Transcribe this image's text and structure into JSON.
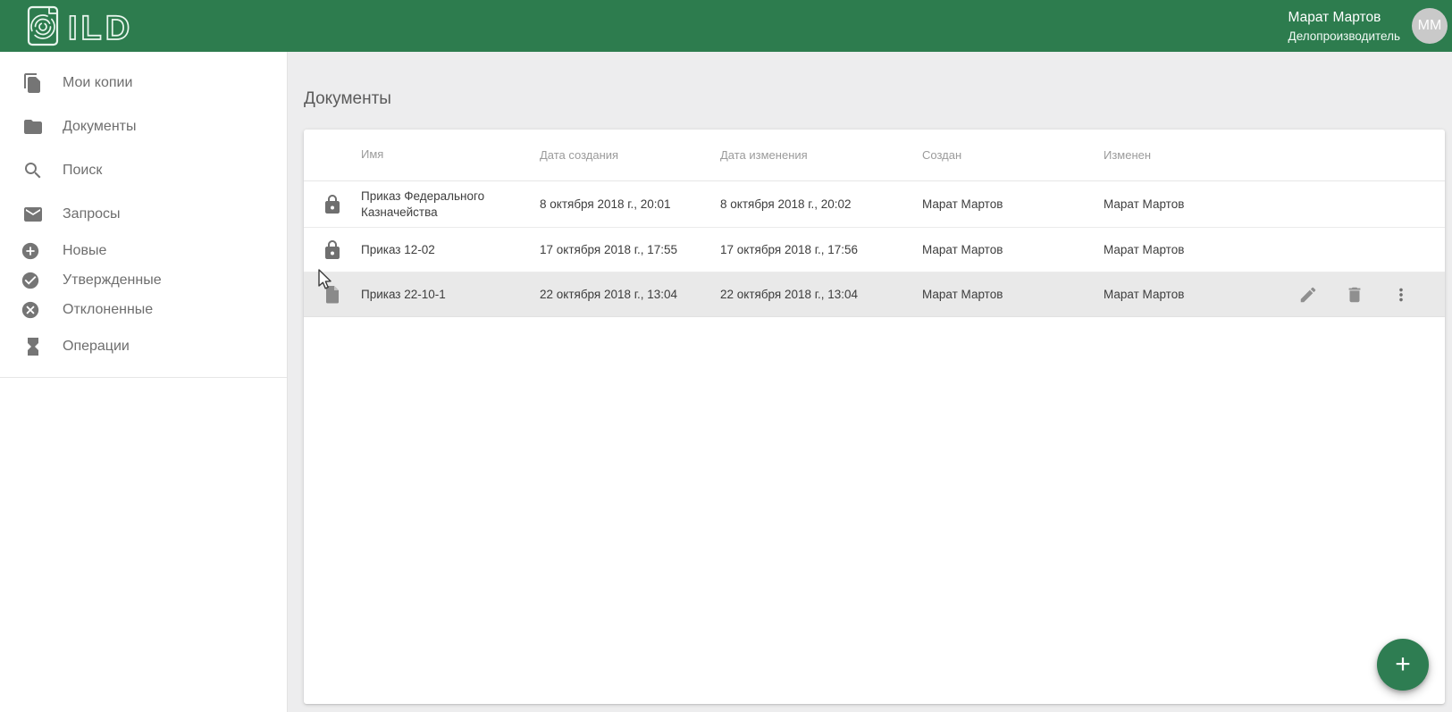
{
  "topbar": {
    "logo_text": "ILD",
    "user": {
      "name": "Марат Мартов",
      "role": "Делопроизводитель",
      "avatar_initials": "MM"
    }
  },
  "sidebar": {
    "items": [
      {
        "label": "Мои копии",
        "icon": "copies-icon",
        "sub": false
      },
      {
        "label": "Документы",
        "icon": "folder-icon",
        "sub": false
      },
      {
        "label": "Поиск",
        "icon": "search-icon",
        "sub": false
      },
      {
        "label": "Запросы",
        "icon": "mail-icon",
        "sub": false
      },
      {
        "label": "Новые",
        "icon": "add-circle-icon",
        "sub": true
      },
      {
        "label": "Утвержденные",
        "icon": "check-circle-icon",
        "sub": true
      },
      {
        "label": "Отклоненные",
        "icon": "cancel-circle-icon",
        "sub": true
      },
      {
        "label": "Операции",
        "icon": "hourglass-icon",
        "sub": false
      }
    ]
  },
  "main": {
    "title": "Документы",
    "table": {
      "columns": [
        "Имя",
        "Дата создания",
        "Дата изменения",
        "Создан",
        "Изменен"
      ],
      "rows": [
        {
          "icon": "lock-icon",
          "name": "Приказ Федерального Казначейства",
          "created": "8 октября 2018 г., 20:01",
          "modified": "8 октября 2018 г., 20:02",
          "created_by": "Марат Мартов",
          "modified_by": "Марат Мартов",
          "selected": false
        },
        {
          "icon": "lock-icon",
          "name": "Приказ 12-02",
          "created": "17 октября 2018 г., 17:55",
          "modified": "17 октября 2018 г., 17:56",
          "created_by": "Марат Мартов",
          "modified_by": "Марат Мартов",
          "selected": false
        },
        {
          "icon": "file-icon",
          "name": "Приказ 22-10-1",
          "created": "22 октября 2018 г., 13:04",
          "modified": "22 октября 2018 г., 13:04",
          "created_by": "Марат Мартов",
          "modified_by": "Марат Мартов",
          "selected": true
        }
      ],
      "row_actions": [
        "edit-icon",
        "delete-icon",
        "more-vert-icon"
      ]
    },
    "fab_label": "+"
  },
  "colors": {
    "brand_green": "#2d7c4e",
    "fab_green": "#2e7d52",
    "row_highlight": "#e9e9e9",
    "icon_gray": "#757575"
  }
}
